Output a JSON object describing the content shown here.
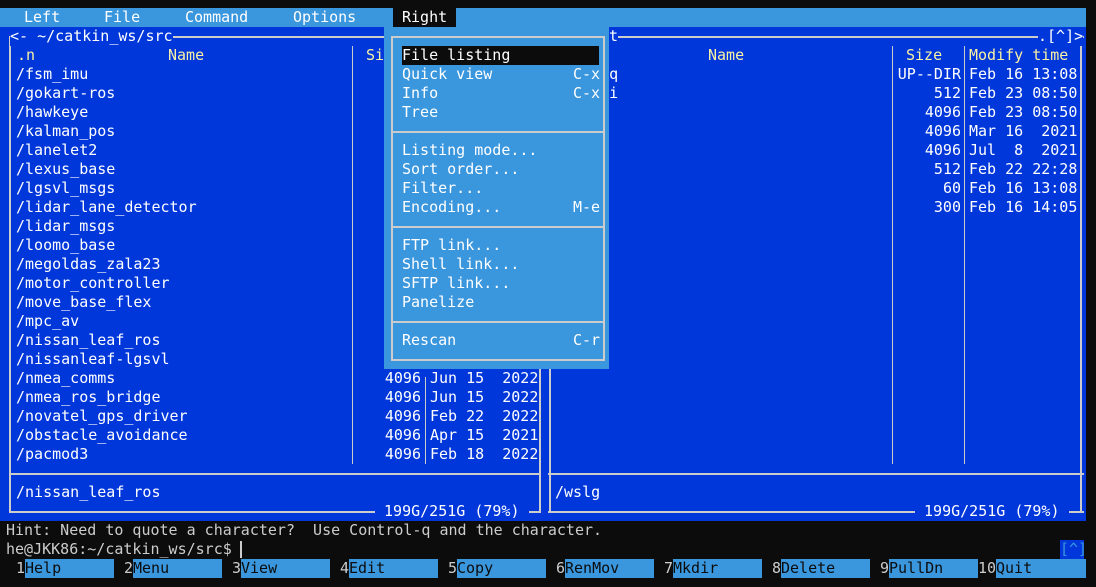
{
  "menubar": {
    "items": [
      {
        "label": "Left",
        "active": false
      },
      {
        "label": "File",
        "active": false
      },
      {
        "label": "Command",
        "active": false
      },
      {
        "label": "Options",
        "active": false
      },
      {
        "label": "Right",
        "active": true
      }
    ]
  },
  "left_panel": {
    "path": "<- ~/catkin_ws/src",
    "col_n": ".n",
    "col_name": "Name",
    "col_size": "Si",
    "rows": [
      {
        "name": "/fsm_imu",
        "size": "",
        "date": ""
      },
      {
        "name": "/gokart-ros",
        "size": "",
        "date": ""
      },
      {
        "name": "/hawkeye",
        "size": "",
        "date": ""
      },
      {
        "name": "/kalman_pos",
        "size": "",
        "date": ""
      },
      {
        "name": "/lanelet2",
        "size": "",
        "date": ""
      },
      {
        "name": "/lexus_base",
        "size": "",
        "date": ""
      },
      {
        "name": "/lgsvl_msgs",
        "size": "",
        "date": ""
      },
      {
        "name": "/lidar_lane_detector",
        "size": "",
        "date": ""
      },
      {
        "name": "/lidar_msgs",
        "size": "",
        "date": ""
      },
      {
        "name": "/loomo_base",
        "size": "",
        "date": ""
      },
      {
        "name": "/megoldas_zala23",
        "size": "",
        "date": ""
      },
      {
        "name": "/motor_controller",
        "size": "",
        "date": ""
      },
      {
        "name": "/move_base_flex",
        "size": "",
        "date": ""
      },
      {
        "name": "/mpc_av",
        "size": "",
        "date": ""
      },
      {
        "name": "/nissan_leaf_ros",
        "size": "",
        "date": ""
      },
      {
        "name": "/nissanleaf-lgsvl",
        "size": "",
        "date": ""
      },
      {
        "name": "/nmea_comms",
        "size": "4096",
        "date": "Jun 15  2022"
      },
      {
        "name": "/nmea_ros_bridge",
        "size": "4096",
        "date": "Jun 15  2022"
      },
      {
        "name": "/novatel_gps_driver",
        "size": "4096",
        "date": "Feb 22  2022"
      },
      {
        "name": "/obstacle_avoidance",
        "size": "4096",
        "date": "Apr 15  2021"
      },
      {
        "name": "/pacmod3",
        "size": "4096",
        "date": "Feb 18  2022"
      }
    ],
    "status": "/nissan_leaf_ros",
    "disk": " 199G/251G (79%) "
  },
  "right_panel": {
    "path_tail": "t",
    "history_tag": ".[^]>",
    "col_name": "Name",
    "col_size": "Size",
    "col_time": "Modify time",
    "rows": [
      {
        "size": "UP--DIR",
        "date": "Feb 16 13:08"
      },
      {
        "size": "512",
        "date": "Feb 23 08:50"
      },
      {
        "size": "4096",
        "date": "Feb 23 08:50"
      },
      {
        "size": "4096",
        "date": "Mar 16  2021"
      },
      {
        "size": "4096",
        "date": "Jul  8  2021"
      },
      {
        "size": "512",
        "date": "Feb 22 22:28"
      },
      {
        "size": "60",
        "date": "Feb 16 13:08"
      },
      {
        "size": "300",
        "date": "Feb 16 14:05"
      }
    ],
    "status": "/wslg",
    "disk": " 199G/251G (79%) "
  },
  "dropdown": {
    "groups": [
      [
        {
          "label": "File listing",
          "key": "",
          "selected": true
        },
        {
          "label": "Quick view",
          "key": "C-x q",
          "selected": false
        },
        {
          "label": "Info",
          "key": "C-x i",
          "selected": false
        },
        {
          "label": "Tree",
          "key": "",
          "selected": false
        }
      ],
      [
        {
          "label": "Listing mode...",
          "key": "",
          "selected": false
        },
        {
          "label": "Sort order...",
          "key": "",
          "selected": false
        },
        {
          "label": "Filter...",
          "key": "",
          "selected": false
        },
        {
          "label": "Encoding...",
          "key": "M-e",
          "selected": false
        }
      ],
      [
        {
          "label": "FTP link...",
          "key": "",
          "selected": false
        },
        {
          "label": "Shell link...",
          "key": "",
          "selected": false
        },
        {
          "label": "SFTP link...",
          "key": "",
          "selected": false
        },
        {
          "label": "Panelize",
          "key": "",
          "selected": false
        }
      ],
      [
        {
          "label": "Rescan",
          "key": "C-r",
          "selected": false
        }
      ]
    ]
  },
  "hint": "Hint: Need to quote a character?  Use Control-q and the character.",
  "prompt": "he@JKK86:~/catkin_ws/src$",
  "history_button": "[^]",
  "fkeys": [
    {
      "num": "1",
      "label": "Help"
    },
    {
      "num": "2",
      "label": "Menu"
    },
    {
      "num": "3",
      "label": "View"
    },
    {
      "num": "4",
      "label": "Edit"
    },
    {
      "num": "5",
      "label": "Copy"
    },
    {
      "num": "6",
      "label": "RenMov"
    },
    {
      "num": "7",
      "label": "Mkdir"
    },
    {
      "num": "8",
      "label": "Delete"
    },
    {
      "num": "9",
      "label": "PullDn"
    },
    {
      "num": "10",
      "label": "Quit"
    }
  ],
  "colors": {
    "panel_bg": "#0037da",
    "menu_bg": "#3a96dd",
    "header_yellow": "#f9f1a5",
    "terminal_bg": "#0c0c0c"
  }
}
